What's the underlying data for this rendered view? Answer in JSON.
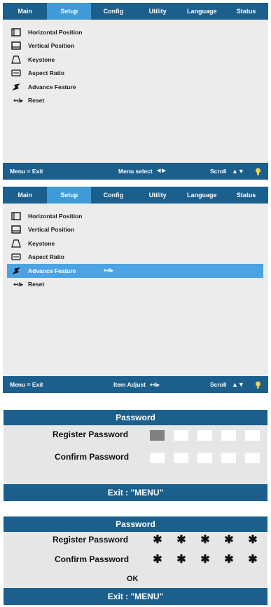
{
  "menu_tabs": [
    "Main",
    "Setup",
    "Config",
    "Utility",
    "Language",
    "Status"
  ],
  "menu_items": [
    "Horizontal Position",
    "Vertical Position",
    "Keystone",
    "Aspect Ratio",
    "Advance Feature",
    "Reset"
  ],
  "reset_icon": "↤/▸",
  "screen1_status": {
    "left": "Menu = Exit",
    "center": "Menu select",
    "center_glyph": "◀ ▶",
    "right": "Scroll",
    "right_glyph": "▲▼"
  },
  "screen2": {
    "selected_item": "Advance Feature",
    "selected_hint": "↤/▸",
    "status": {
      "left": "Menu = Exit",
      "center": "Item Adjust",
      "center_glyph": "↤/▸",
      "right": "Scroll",
      "right_glyph": "▲▼"
    }
  },
  "password_dialog_1": {
    "title": "Password",
    "register_label": "Register Password",
    "confirm_label": "Confirm Password",
    "exit_label": "Exit  :  \"MENU\""
  },
  "password_dialog_2": {
    "title": "Password",
    "register_label": "Register Password",
    "confirm_label": "Confirm Password",
    "mask_char": "✱",
    "ok_label": "OK",
    "exit_label": "Exit  :  \"MENU\""
  },
  "icons": [
    "horizontal-position-icon",
    "vertical-position-icon",
    "keystone-icon",
    "aspect-ratio-icon",
    "advance-feature-icon",
    "reset-icon",
    "bulb-icon"
  ],
  "colors": {
    "menu_bar": "#1b5f8d",
    "active_tab": "#3f9ad8",
    "selection": "#4ba3e3",
    "panel_bg": "#ececec",
    "dialog_bg": "#e6e6e6"
  }
}
